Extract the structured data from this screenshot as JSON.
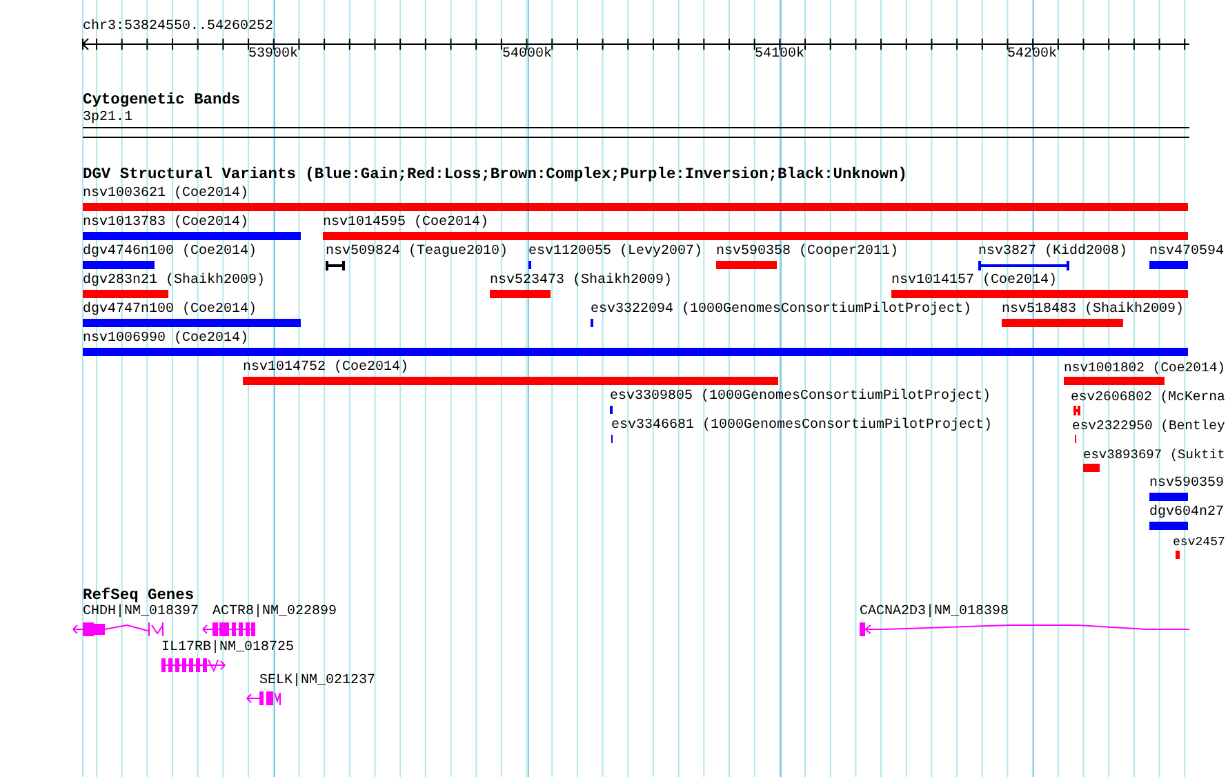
{
  "ruler": {
    "position": "chr3:53824550..54260252",
    "ticks": [
      "53900k",
      "54000k",
      "54100k",
      "54200k"
    ]
  },
  "cytogenetic_bands": {
    "title": "Cytogenetic Bands",
    "band": "3p21.1"
  },
  "dgv_track": {
    "title": "DGV Structural Variants (Blue:Gain;Red:Loss;Brown:Complex;Purple:Inversion;Black:Unknown)",
    "features": [
      {
        "label": "nsv1003621 (Coe2014)",
        "color": "#ff0000",
        "kind": "bar"
      },
      {
        "label": "nsv1013783 (Coe2014)",
        "color": "#0000ff",
        "kind": "bar"
      },
      {
        "label": "nsv1014595 (Coe2014)",
        "color": "#ff0000",
        "kind": "bar"
      },
      {
        "label": "dgv4746n100 (Coe2014)",
        "color": "#0000ff",
        "kind": "bar"
      },
      {
        "label": "nsv509824 (Teague2010)",
        "color": "#000000",
        "kind": "bracket"
      },
      {
        "label": "esv1120055 (Levy2007)",
        "color": "#0000ff",
        "kind": "bar"
      },
      {
        "label": "nsv590358 (Cooper2011)",
        "color": "#ff0000",
        "kind": "bar"
      },
      {
        "label": "nsv3827 (Kidd2008)",
        "color": "#0000ff",
        "kind": "bracket"
      },
      {
        "label": "nsv470594",
        "color": "#0000ff",
        "kind": "bar"
      },
      {
        "label": "dgv283n21 (Shaikh2009)",
        "color": "#ff0000",
        "kind": "bar"
      },
      {
        "label": "nsv523473 (Shaikh2009)",
        "color": "#ff0000",
        "kind": "bar"
      },
      {
        "label": "nsv1014157 (Coe2014)",
        "color": "#ff0000",
        "kind": "bar"
      },
      {
        "label": "dgv4747n100 (Coe2014)",
        "color": "#0000ff",
        "kind": "bar"
      },
      {
        "label": "esv3322094 (1000GenomesConsortiumPilotProject)",
        "color": "#0000ff",
        "kind": "bar"
      },
      {
        "label": "nsv518483 (Shaikh2009)",
        "color": "#ff0000",
        "kind": "bar"
      },
      {
        "label": "nsv1006990 (Coe2014)",
        "color": "#0000ff",
        "kind": "bar"
      },
      {
        "label": "nsv1014752 (Coe2014)",
        "color": "#ff0000",
        "kind": "bar"
      },
      {
        "label": "nsv1001802 (Coe2014)",
        "color": "#ff0000",
        "kind": "bar"
      },
      {
        "label": "esv3309805 (1000GenomesConsortiumPilotProject)",
        "color": "#0000ff",
        "kind": "bar"
      },
      {
        "label": "esv2606802 (McKerna",
        "color": "#ff0000",
        "kind": "bracket"
      },
      {
        "label": "esv3346681 (1000GenomesConsortiumPilotProject)",
        "color": "#0000ff",
        "kind": "bar"
      },
      {
        "label": "esv2322950 (Bentley",
        "color": "#ff0000",
        "kind": "bar"
      },
      {
        "label": "esv3893697 (Suktit",
        "color": "#ff0000",
        "kind": "bar"
      },
      {
        "label": "nsv590359",
        "color": "#0000ff",
        "kind": "bar"
      },
      {
        "label": "dgv604n27",
        "color": "#0000ff",
        "kind": "bar"
      },
      {
        "label": "esv2457",
        "color": "#ff0000",
        "kind": "bar"
      }
    ]
  },
  "refseq_genes": {
    "title": "RefSeq Genes",
    "genes": [
      {
        "label": "CHDH|NM_018397"
      },
      {
        "label": "ACTR8|NM_022899"
      },
      {
        "label": "IL17RB|NM_018725"
      },
      {
        "label": "SELK|NM_021237"
      },
      {
        "label": "CACNA2D3|NM_018398"
      }
    ]
  }
}
